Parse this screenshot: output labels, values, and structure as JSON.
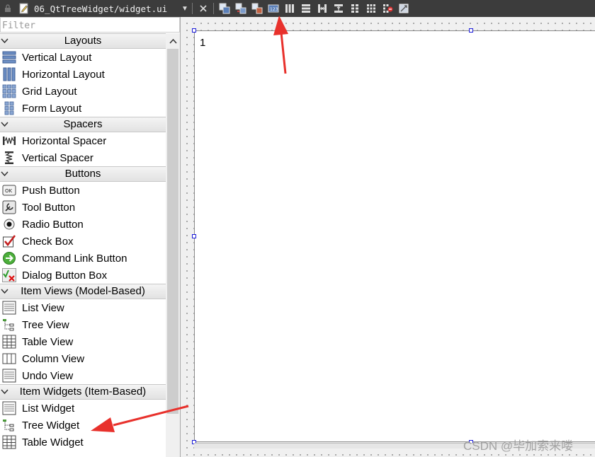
{
  "toolbar": {
    "file_name": "06_QtTreeWidget/widget.ui",
    "buttons": [
      "edit-widgets-icon",
      "edit-signals-slots-icon",
      "edit-buddies-icon",
      "edit-tab-order-icon",
      "layout-horizontal-icon",
      "layout-vertical-icon",
      "layout-horizontal-splitter-icon",
      "layout-vertical-splitter-icon",
      "layout-form-icon",
      "layout-grid-icon",
      "break-layout-icon",
      "adjust-size-icon"
    ]
  },
  "widget_box": {
    "filter_placeholder": "Filter",
    "categories": [
      {
        "title": "Layouts",
        "items": [
          {
            "label": "Vertical Layout",
            "icon": "vertical-layout-icon"
          },
          {
            "label": "Horizontal Layout",
            "icon": "horizontal-layout-icon"
          },
          {
            "label": "Grid Layout",
            "icon": "grid-layout-icon"
          },
          {
            "label": "Form Layout",
            "icon": "form-layout-icon"
          }
        ]
      },
      {
        "title": "Spacers",
        "items": [
          {
            "label": "Horizontal Spacer",
            "icon": "horizontal-spacer-icon"
          },
          {
            "label": "Vertical Spacer",
            "icon": "vertical-spacer-icon"
          }
        ]
      },
      {
        "title": "Buttons",
        "items": [
          {
            "label": "Push Button",
            "icon": "push-button-icon"
          },
          {
            "label": "Tool Button",
            "icon": "tool-button-icon"
          },
          {
            "label": "Radio Button",
            "icon": "radio-button-icon"
          },
          {
            "label": "Check Box",
            "icon": "check-box-icon"
          },
          {
            "label": "Command Link Button",
            "icon": "command-link-icon"
          },
          {
            "label": "Dialog Button Box",
            "icon": "dialog-button-box-icon"
          }
        ]
      },
      {
        "title": "Item Views (Model-Based)",
        "items": [
          {
            "label": "List View",
            "icon": "list-view-icon"
          },
          {
            "label": "Tree View",
            "icon": "tree-view-icon"
          },
          {
            "label": "Table View",
            "icon": "table-view-icon"
          },
          {
            "label": "Column View",
            "icon": "column-view-icon"
          },
          {
            "label": "Undo View",
            "icon": "undo-view-icon"
          }
        ]
      },
      {
        "title": "Item Widgets (Item-Based)",
        "items": [
          {
            "label": "List Widget",
            "icon": "list-widget-icon"
          },
          {
            "label": "Tree Widget",
            "icon": "tree-widget-icon"
          },
          {
            "label": "Table Widget",
            "icon": "table-widget-icon"
          }
        ]
      }
    ]
  },
  "form": {
    "content_text": "1"
  },
  "watermark": "CSDN @毕加索来喽",
  "colors": {
    "toolbar_bg": "#3c3c3c",
    "arrow": "#e8312c",
    "handle": "#1a1ad8"
  }
}
